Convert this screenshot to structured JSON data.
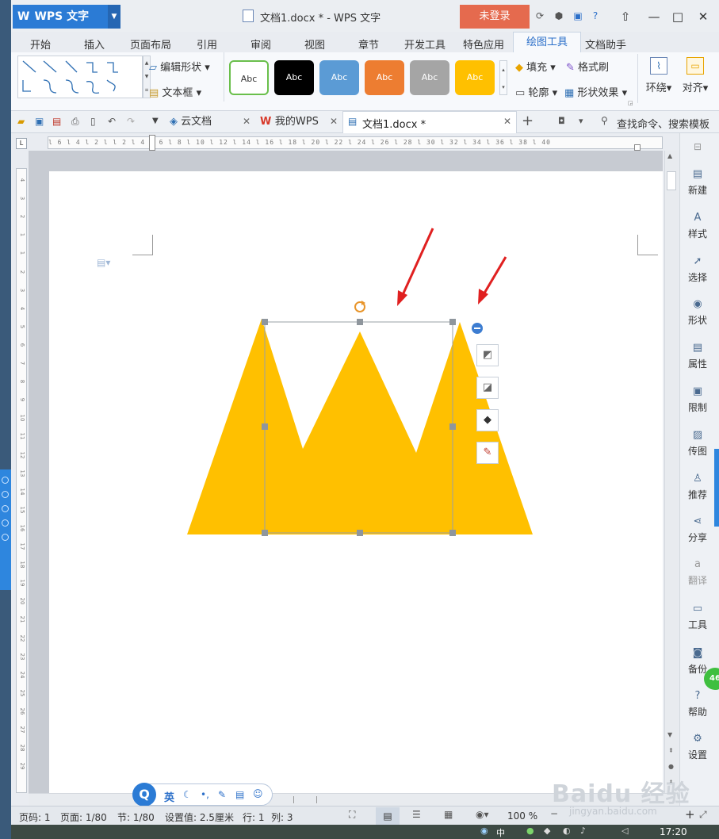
{
  "app": {
    "name": "WPS 文字",
    "logo": "W",
    "title": "文档1.docx * - WPS 文字",
    "login": "未登录"
  },
  "menu_tabs": [
    "开始",
    "插入",
    "页面布局",
    "引用",
    "审阅",
    "视图",
    "章节",
    "开发工具",
    "特色应用",
    "绘图工具",
    "文档助手"
  ],
  "active_tab": "绘图工具",
  "ribbon": {
    "edit_shape": "编辑形状",
    "text_box": "文本框",
    "styles": [
      "Abc",
      "Abc",
      "Abc",
      "Abc",
      "Abc",
      "Abc"
    ],
    "fill": "填充",
    "format_painter": "格式刷",
    "outline": "轮廓",
    "shape_effects": "形状效果",
    "wrap": "环绕",
    "align": "对齐"
  },
  "doc_tabs": [
    "云文档",
    "我的WPS",
    "文档1.docx *"
  ],
  "search_placeholder": "查找命令、搜索模板",
  "ruler_h": "l 6 l 4 l 2 l l 2 l 4 l 6 l 8 l 10 l 12 l 14 l 16 l 18 l 20 l 22 l 24 l 26 l 28 l 30 l 32 l 34 l 36 l 38 l 40",
  "ruler_v": [
    "4",
    "3",
    "2",
    "1",
    "1",
    "2",
    "3",
    "4",
    "5",
    "6",
    "7",
    "8",
    "9",
    "10",
    "11",
    "12",
    "13",
    "14",
    "15",
    "16",
    "17",
    "18",
    "19",
    "20",
    "21",
    "22",
    "23",
    "24",
    "25",
    "26",
    "27",
    "28",
    "29"
  ],
  "right_panel": [
    "新建",
    "样式",
    "选择",
    "形状",
    "属性",
    "限制",
    "传图",
    "推荐",
    "分享",
    "翻译",
    "工具",
    "备份",
    "帮助",
    "设置"
  ],
  "status": {
    "page_num": "页码: 1",
    "page": "页面: 1/80",
    "section": "节: 1/80",
    "setting": "设置值: 2.5厘米",
    "row": "行: 1",
    "col": "列: 3",
    "zoom": "100 %"
  },
  "ime": {
    "logo": "Q",
    "lang": "英"
  },
  "badge": "46",
  "taskbar": {
    "time": "17:20",
    "lang": "中"
  },
  "watermark": {
    "text": "Baidu 经验",
    "url": "jingyan.baidu.com"
  },
  "colors": {
    "shape": "#ffc000",
    "accent": "#2b7bd5",
    "login": "#e56a4e",
    "arrow": "#e02020"
  }
}
